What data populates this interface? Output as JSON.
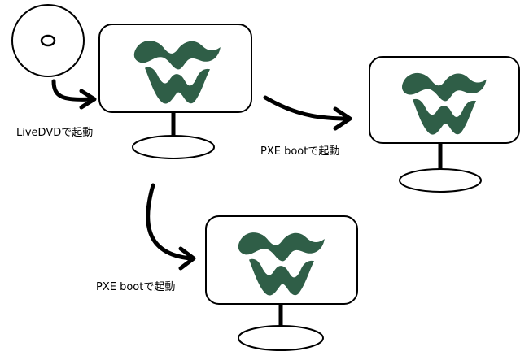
{
  "diagram": {
    "dvd_label": "LiveDVDで起動",
    "pxe_label_right": "PXE bootで起動",
    "pxe_label_bottom": "PXE bootで起動",
    "logo_icon": "w-wave-logo-icon",
    "disc_icon": "dvd-disc-icon",
    "colors": {
      "logo": "#2f5e47",
      "stroke": "#000000",
      "background": "#ffffff"
    }
  }
}
